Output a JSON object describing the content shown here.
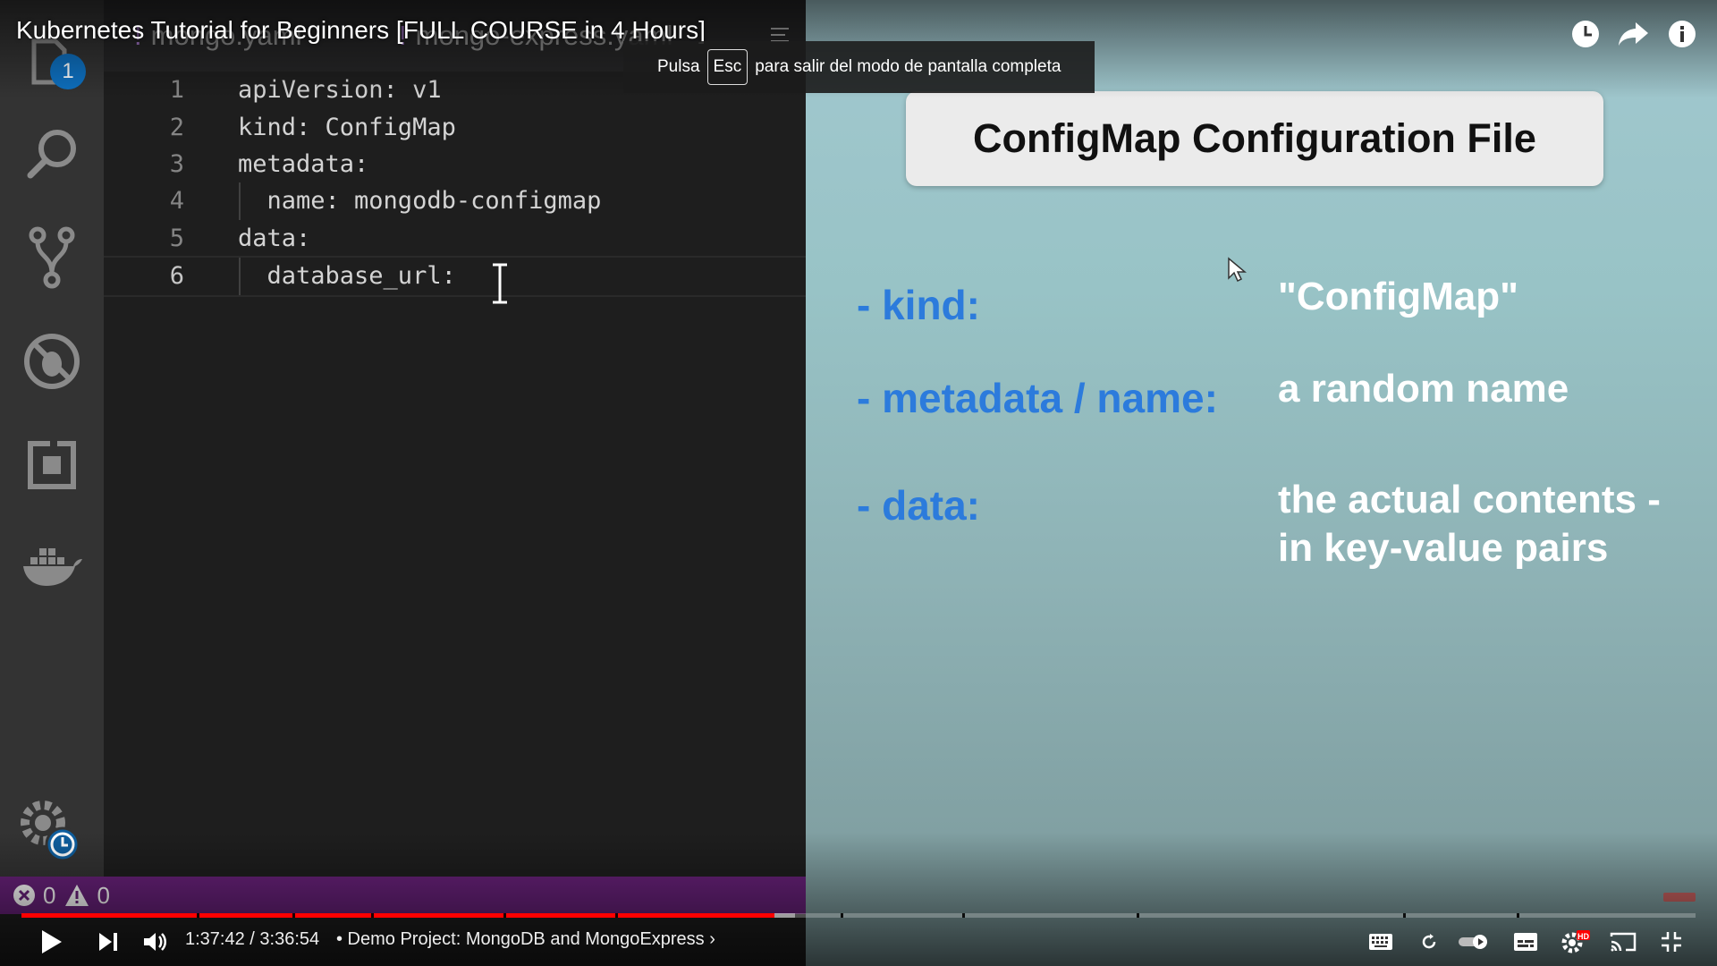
{
  "player": {
    "video_title": "Kubernetes Tutorial for Beginners [FULL COURSE in 4 Hours]",
    "fullscreen_notice": {
      "prefix": "Pulsa",
      "key": "Esc",
      "suffix": "para salir del modo de pantalla completa"
    },
    "time_current": "1:37:42",
    "time_separator": "/",
    "time_total": "3:36:54",
    "chapter_title": "• Demo Project: MongoDB and MongoExpress ›",
    "progress_played": 0.45,
    "progress_loaded": 0.462,
    "icons": {
      "watch_later": "clock-icon",
      "share": "share-arrow-icon",
      "info": "info-icon",
      "play": "play-icon",
      "next": "next-icon",
      "volume": "volume-icon",
      "keyboard": "keyboard-icon",
      "loop": "loop-icon",
      "autoplay": "autoplay-toggle-icon",
      "subtitles": "subtitles-icon",
      "settings": "settings-hd-icon",
      "cast": "cast-icon",
      "exit_fullscreen": "exit-fullscreen-icon"
    },
    "hd_badge": "HD"
  },
  "vscode": {
    "tabs": [
      {
        "label": "mongo.yaml"
      },
      {
        "label": "mongo-express.yaml"
      }
    ],
    "activity_badge": "1",
    "lines": [
      {
        "num": "1",
        "text": "apiVersion: v1"
      },
      {
        "num": "2",
        "text": "kind: ConfigMap"
      },
      {
        "num": "3",
        "text": "metadata:"
      },
      {
        "num": "4",
        "text": "  name: mongodb-configmap"
      },
      {
        "num": "5",
        "text": "data:"
      },
      {
        "num": "6",
        "text": "  database_url: "
      }
    ],
    "status": {
      "errors": "0",
      "warnings": "0"
    },
    "colors": {
      "status_bar": "#68217a",
      "activity_bar": "#333333",
      "editor": "#1e1e1e",
      "badge": "#0e70c0"
    }
  },
  "slide": {
    "title": "ConfigMap Configuration File",
    "rows": [
      {
        "key": "- kind:",
        "value": "\"ConfigMap\""
      },
      {
        "key": "- metadata / name:",
        "value": "a random name"
      },
      {
        "key": "- data:",
        "value_line1": "the actual contents -",
        "value_line2": "in key-value pairs"
      }
    ],
    "colors": {
      "key": "#2c7bdc",
      "value": "#ffffff",
      "title_box": "#ebebeb"
    }
  }
}
